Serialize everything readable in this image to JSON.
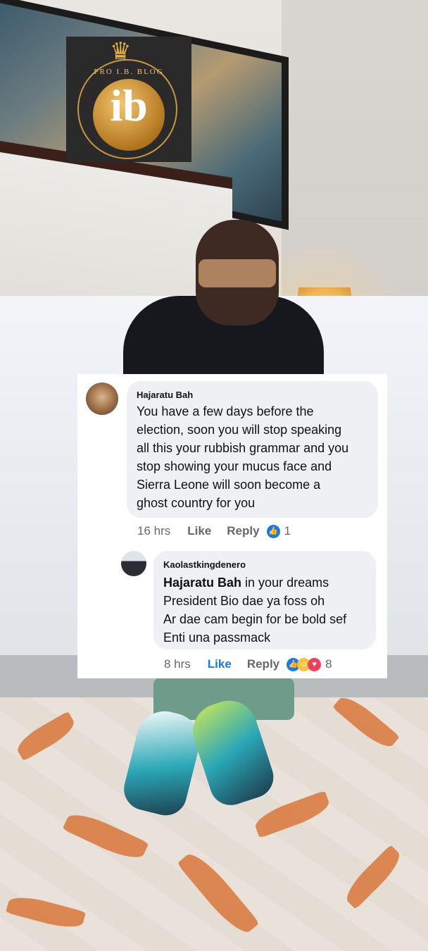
{
  "watermark": {
    "text": "PRO I.B. BLOG",
    "monogram": "ib"
  },
  "comments": [
    {
      "author": "Hajaratu Bah",
      "text": "You have a few days before the\nelection,  soon you will stop speaking\nall this your rubbish grammar and you\nstop showing your mucus face and\nSierra Leone will soon become a\nghost country for you",
      "time": "16 hrs",
      "like_label": "Like",
      "reply_label": "Reply",
      "reaction_count": "1",
      "reactions": [
        "like-icon"
      ]
    },
    {
      "author": "Kaolastkingdenero",
      "mention": "Hajaratu Bah",
      "text": " in your dreams\nPresident Bio dae ya foss oh\nAr dae cam begin for be bold sef\nEnti una passmack",
      "time": "8 hrs",
      "like_label": "Like",
      "reply_label": "Reply",
      "reaction_count": "8",
      "reactions": [
        "like-icon",
        "haha-icon",
        "love-icon"
      ]
    }
  ],
  "colors": {
    "accent": "#1877f2",
    "bubble": "#eef0f3",
    "meta_text": "#65676b"
  }
}
